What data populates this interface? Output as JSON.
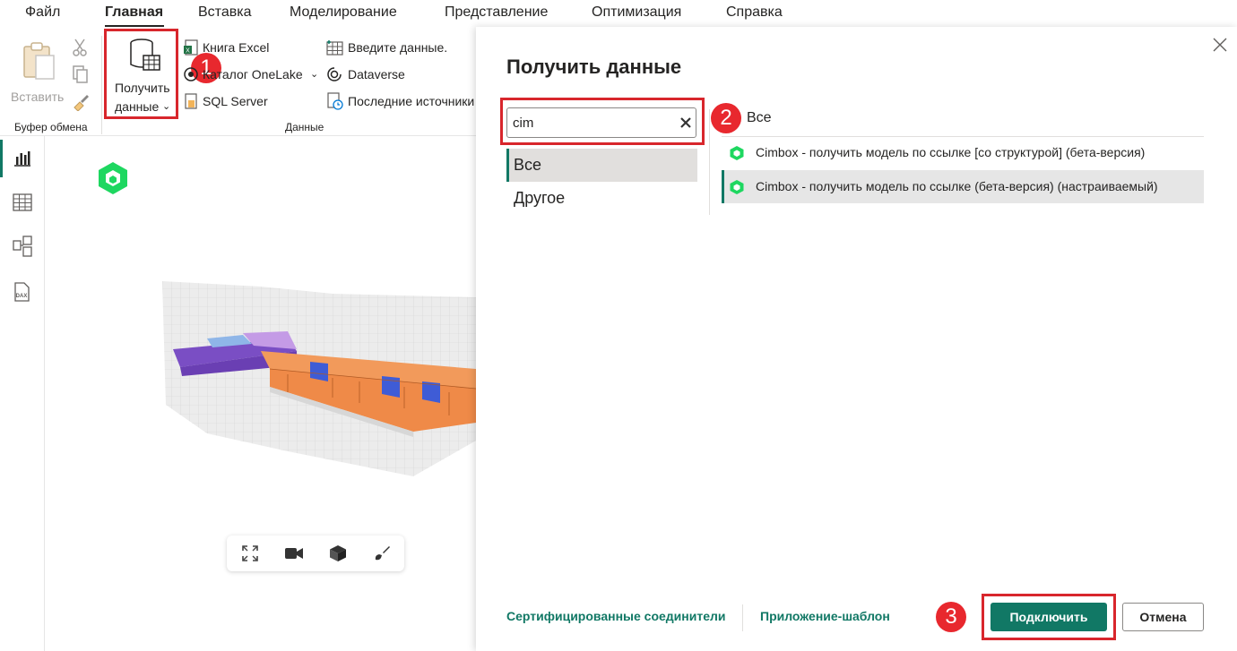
{
  "menu": {
    "items": [
      "Файл",
      "Главная",
      "Вставка",
      "Моделирование",
      "Представление",
      "Оптимизация",
      "Справка"
    ],
    "active": "Главная"
  },
  "ribbon": {
    "clipboard": {
      "paste_label": "Вставить",
      "group_label": "Буфер обмена"
    },
    "data": {
      "get_data_line1": "Получить",
      "get_data_line2": "данные",
      "excel": "Книга Excel",
      "onelake": "Каталог OneLake",
      "sql": "SQL Server",
      "enter_data": "Введите данные.",
      "dataverse": "Dataverse",
      "recent": "Последние источники",
      "group_label": "Данные"
    }
  },
  "annotations": {
    "badge1": "1",
    "badge2": "2",
    "badge3": "3"
  },
  "leftrail": {
    "icons": [
      "report-view-icon",
      "table-view-icon",
      "model-view-icon",
      "dax-query-icon"
    ]
  },
  "viewer_toolbar": {
    "icons": [
      "expand-icon",
      "camera-icon",
      "cube-icon",
      "brush-icon"
    ]
  },
  "dialog": {
    "title": "Получить данные",
    "search": {
      "value": "cim"
    },
    "categories": [
      "Все",
      "Другое"
    ],
    "selected_category": "Все",
    "list_header": "Все",
    "results": [
      "Cimbox - получить модель по ссылке [со структурой] (бета-версия)",
      "Cimbox - получить модель по ссылке (бета-версия) (настраиваемый)"
    ],
    "selected_result": 1,
    "footer": {
      "certified_link": "Сертифицированные соединители",
      "template_link": "Приложение-шаблон",
      "connect_label": "Подключить",
      "cancel_label": "Отмена"
    }
  },
  "colors": {
    "accent": "#117865",
    "highlight_red": "#d8262c",
    "cimbox_green": "#1ed760"
  }
}
